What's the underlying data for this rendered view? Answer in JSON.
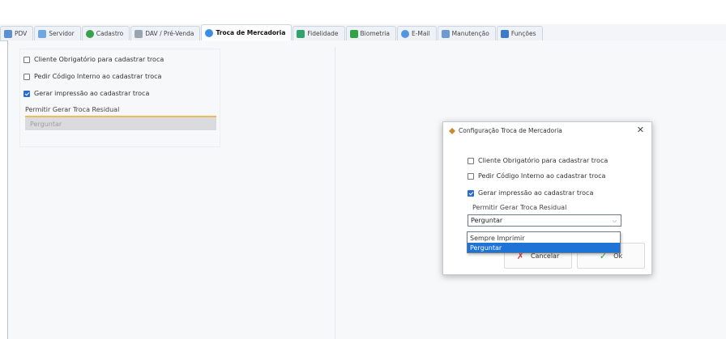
{
  "tabs": [
    {
      "label": "PDV",
      "icon": "pdv-icon",
      "color": "#5a8fd6",
      "active": false
    },
    {
      "label": "Servidor",
      "icon": "server-icon",
      "color": "#6ea6e8",
      "active": false
    },
    {
      "label": "Cadastro",
      "icon": "cadastro-icon",
      "color": "#3aa14b",
      "active": false
    },
    {
      "label": "DAV / Pré-Venda",
      "icon": "dav-icon",
      "color": "#9aa4b0",
      "active": false
    },
    {
      "label": "Troca de Mercadoria",
      "icon": "exchange-icon",
      "color": "#3c8fe0",
      "active": true
    },
    {
      "label": "Fidelidade",
      "icon": "fidelity-icon",
      "color": "#2fa36b",
      "active": false
    },
    {
      "label": "Biometria",
      "icon": "biometry-icon",
      "color": "#33a245",
      "active": false
    },
    {
      "label": "E-Mail",
      "icon": "email-icon",
      "color": "#4f95df",
      "active": false
    },
    {
      "label": "Manutenção",
      "icon": "maintenance-icon",
      "color": "#6c9ad1",
      "active": false
    },
    {
      "label": "Funções",
      "icon": "functions-icon",
      "color": "#3d7bc9",
      "active": false
    }
  ],
  "panel": {
    "checkboxes": [
      {
        "label": "Cliente Obrigatório para cadastrar troca",
        "checked": false
      },
      {
        "label": "Pedir Código Interno ao cadastrar troca",
        "checked": false
      },
      {
        "label": "Gerar impressão ao cadastrar troca",
        "checked": true
      }
    ],
    "field_label": "Permitir Gerar Troca Residual",
    "field_value": "Perguntar"
  },
  "dialog": {
    "title": "Configuração Troca de Mercadoria",
    "close_glyph": "✕",
    "checkboxes": [
      {
        "label": "Cliente Obrigatório para cadastrar troca",
        "checked": false
      },
      {
        "label": "Pedir Código Interno ao cadastrar troca",
        "checked": false
      },
      {
        "label": "Gerar impressão ao cadastrar troca",
        "checked": true
      }
    ],
    "field_label": "Permitir Gerar Troca Residual",
    "select_value": "Perguntar",
    "options": [
      "Sempre Imprimir",
      "Perguntar"
    ],
    "selected_option": "Perguntar",
    "cancel_label": "Cancelar",
    "ok_label": "Ok"
  }
}
